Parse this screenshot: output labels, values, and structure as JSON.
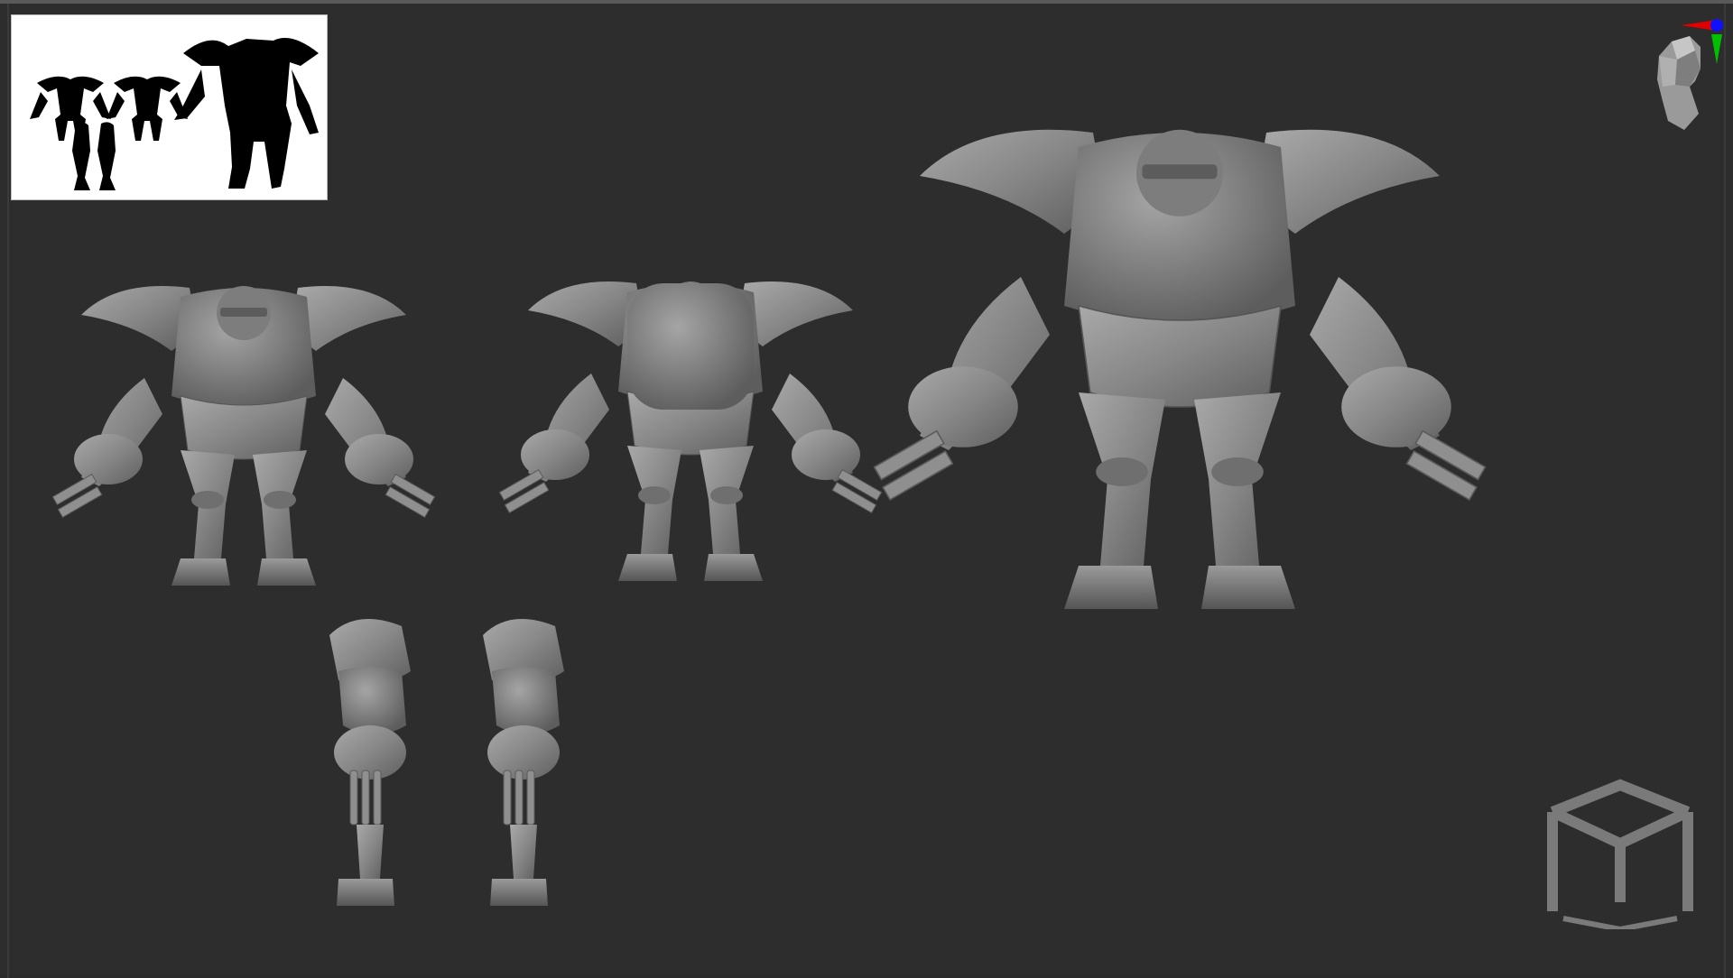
{
  "app": {
    "name": ""
  },
  "viewport": {
    "background": "#2d2d2d",
    "model_color": "#8c8c8c",
    "shadow_color": "#5c5c5c",
    "highlight_color": "#b3b3b3"
  },
  "thumbnail": {
    "background": "#ffffff",
    "silhouette_color": "#000000"
  },
  "orientation_gizmo": {
    "icons": [
      "head-icon",
      "axis-x-icon",
      "axis-y-icon",
      "axis-z-icon"
    ],
    "axis_colors": {
      "x": "#e00000",
      "y": "#00c000",
      "z": "#1010ff"
    }
  },
  "views": [
    {
      "name": "front-view"
    },
    {
      "name": "back-view"
    },
    {
      "name": "side-view-left"
    },
    {
      "name": "side-view-right"
    },
    {
      "name": "perspective-view"
    }
  ],
  "watermark": {
    "icon": "cube-logo-icon",
    "color": "#7a7a7a"
  }
}
